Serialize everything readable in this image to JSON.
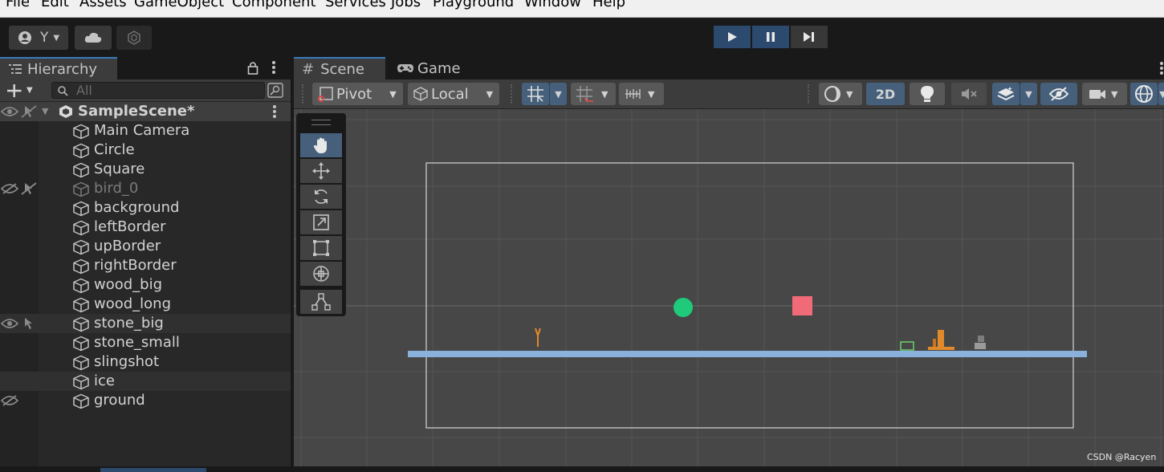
{
  "menu": [
    "File",
    "Edit",
    "Assets",
    "GameObject",
    "Component",
    "Services",
    "Jobs",
    "Playground",
    "Window",
    "Help"
  ],
  "toolbar": {
    "account_label": "Y",
    "play_icon": "play-icon",
    "pause_icon": "pause-icon",
    "step_icon": "step-icon"
  },
  "hierarchy": {
    "tab_label": "Hierarchy",
    "search_placeholder": "All",
    "scene_name": "SampleScene*",
    "items": [
      {
        "label": "Main Camera"
      },
      {
        "label": "Circle"
      },
      {
        "label": "Square"
      },
      {
        "label": "bird_0",
        "hidden": true
      },
      {
        "label": "background"
      },
      {
        "label": "leftBorder"
      },
      {
        "label": "upBorder"
      },
      {
        "label": "rightBorder"
      },
      {
        "label": "wood_big"
      },
      {
        "label": "wood_long"
      },
      {
        "label": "stone_big"
      },
      {
        "label": "stone_small"
      },
      {
        "label": "slingshot"
      },
      {
        "label": "ice"
      },
      {
        "label": "ground"
      }
    ]
  },
  "scene": {
    "tab_scene": "Scene",
    "tab_game": "Game",
    "pivot_label": "Pivot",
    "local_label": "Local",
    "mode_2d_label": "2D"
  },
  "colors": {
    "accent": "#3a79bb",
    "circle": "#1fcb7a",
    "square": "#f06a78",
    "ground": "#8ab0dc",
    "wood": "#e08a2a"
  },
  "watermark": "CSDN @Racyen"
}
